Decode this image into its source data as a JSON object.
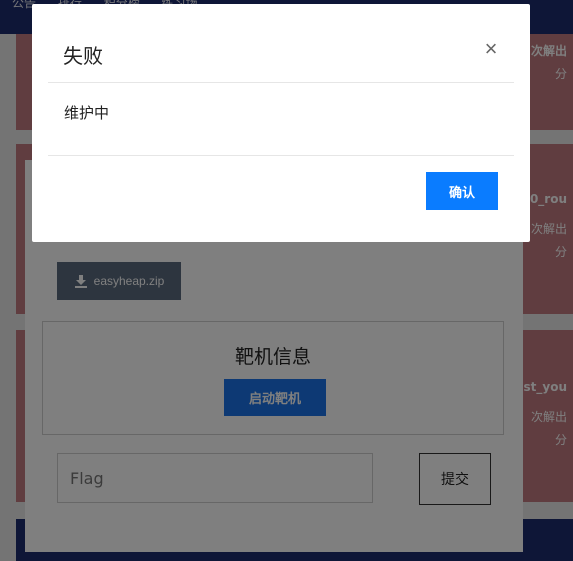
{
  "nav": {
    "items": [
      "公告",
      "排行",
      "积分榜",
      "练习场"
    ]
  },
  "cards": [
    {
      "title": "",
      "sub": ""
    },
    {
      "title": "",
      "sub": ""
    },
    {
      "title": "",
      "sub": ""
    },
    {
      "title": "次解出",
      "sub": "分"
    },
    {
      "title": "0_rou",
      "sub": "次解出"
    },
    {
      "title": "st_you",
      "sub": "次解出"
    }
  ],
  "card_sub2": [
    "分",
    "分"
  ],
  "challenge": {
    "download_label": "easyheap.zip",
    "target_title": "靶机信息",
    "start_label": "启动靶机",
    "flag_placeholder": "Flag",
    "submit_label": "提交"
  },
  "modal": {
    "title": "失败",
    "close_symbol": "×",
    "body": "维护中",
    "confirm_label": "确认"
  }
}
